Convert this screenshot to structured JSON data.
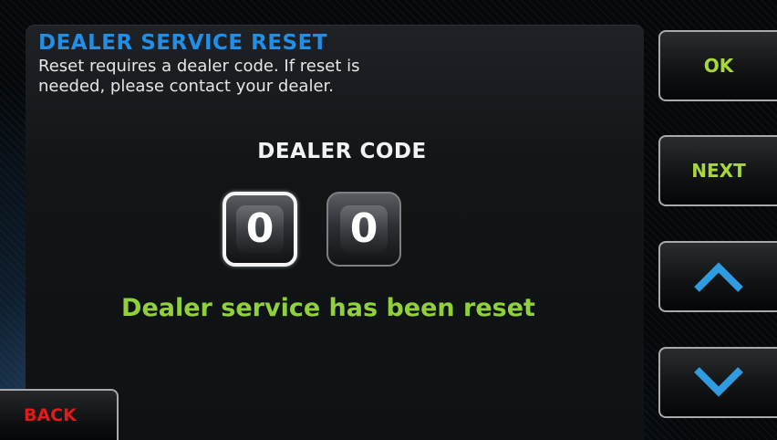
{
  "screen": {
    "title": "DEALER SERVICE RESET",
    "description_line1": "Reset requires a dealer code. If reset is",
    "description_line2": "needed, please contact your dealer."
  },
  "dealer_code": {
    "label": "DEALER CODE",
    "digits": [
      "0",
      "0"
    ],
    "selected_index": 0
  },
  "status": {
    "message": "Dealer service has been reset",
    "color": "#8fd13a"
  },
  "buttons": {
    "ok": "OK",
    "next": "NEXT",
    "up_icon": "chevron-up-icon",
    "down_icon": "chevron-down-icon",
    "back": "BACK"
  },
  "colors": {
    "title": "#1f8fe8",
    "button_text": "#a8d838",
    "back_text": "#e11b1b",
    "arrow": "#2f9be0"
  }
}
